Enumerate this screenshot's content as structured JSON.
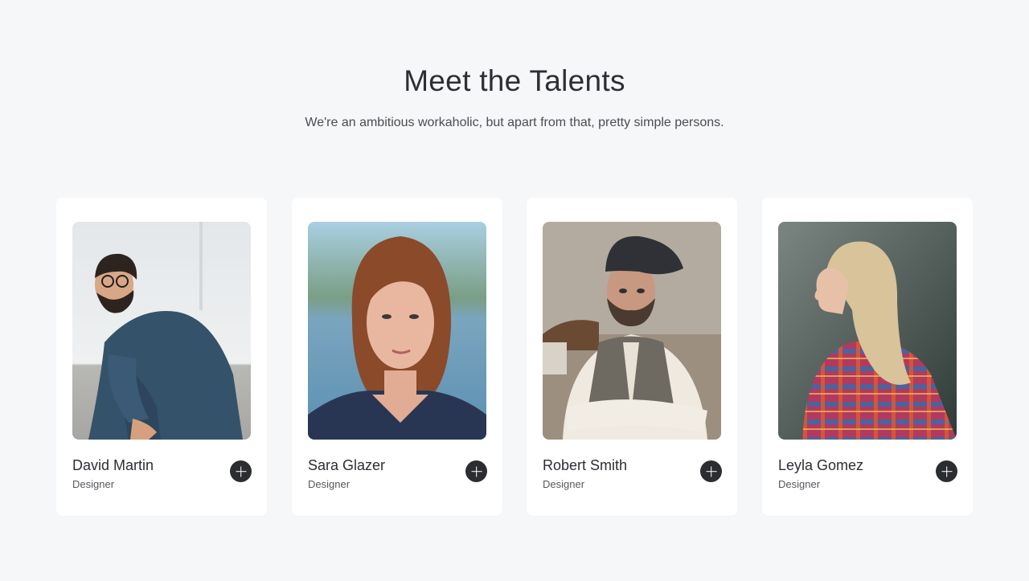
{
  "section": {
    "title": "Meet the Talents",
    "subtitle": "We're an ambitious workaholic, but apart from that, pretty simple persons."
  },
  "talents": [
    {
      "name": "David Martin",
      "role": "Designer"
    },
    {
      "name": "Sara Glazer",
      "role": "Designer"
    },
    {
      "name": "Robert Smith",
      "role": "Designer"
    },
    {
      "name": "Leyla Gomez",
      "role": "Designer"
    }
  ],
  "icons": {
    "expand": "plus-icon"
  },
  "colors": {
    "background": "#f6f7f9",
    "card": "#ffffff",
    "button": "#2b2d31",
    "text": "#2b2e33"
  }
}
